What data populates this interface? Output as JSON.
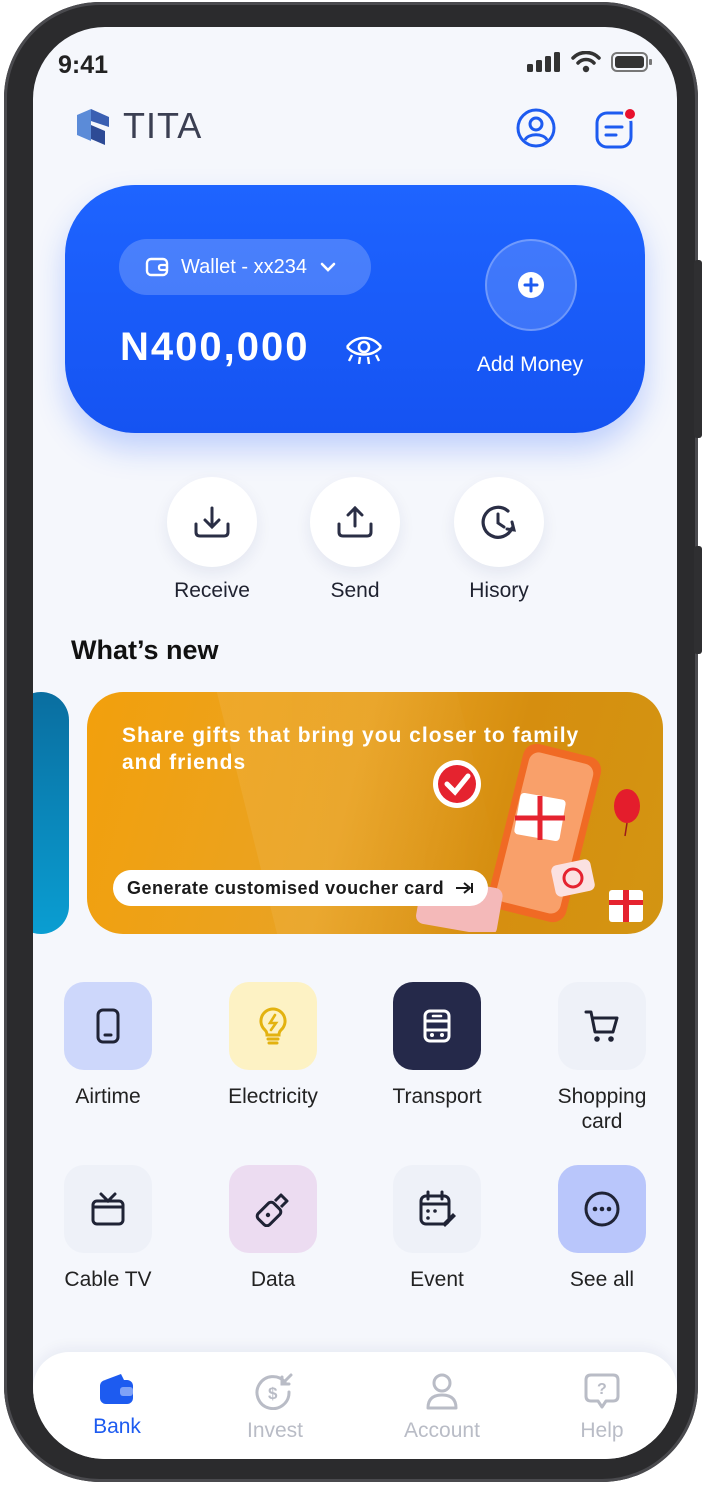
{
  "status": {
    "time": "9:41"
  },
  "brand": {
    "name": "TITA"
  },
  "wallet": {
    "account_label": "Wallet - xx234",
    "balance": "N400,000",
    "add_money_label": "Add Money"
  },
  "quick_actions": [
    {
      "label": "Receive",
      "icon": "download-icon"
    },
    {
      "label": "Send",
      "icon": "upload-icon"
    },
    {
      "label": "Hisory",
      "icon": "history-icon"
    }
  ],
  "whats_new": {
    "title": "What’s new",
    "promo": {
      "headline": "Share gifts that bring you closer to family and friends",
      "cta": "Generate customised voucher card"
    }
  },
  "services": [
    {
      "label": "Airtime",
      "icon": "phone-icon"
    },
    {
      "label": "Electricity",
      "icon": "bulb-icon"
    },
    {
      "label": "Transport",
      "icon": "bus-icon"
    },
    {
      "label": "Shopping card",
      "icon": "cart-icon"
    },
    {
      "label": "Cable TV",
      "icon": "tv-icon"
    },
    {
      "label": "Data",
      "icon": "usb-icon"
    },
    {
      "label": "Event",
      "icon": "calendar-icon"
    },
    {
      "label": "See all",
      "icon": "more-icon"
    }
  ],
  "tabs": [
    {
      "label": "Bank",
      "active": true
    },
    {
      "label": "Invest",
      "active": false
    },
    {
      "label": "Account",
      "active": false
    },
    {
      "label": "Help",
      "active": false
    }
  ],
  "colors": {
    "primary": "#1D5BF0",
    "promo": "#EBA21A",
    "notification": "#E8112D"
  }
}
